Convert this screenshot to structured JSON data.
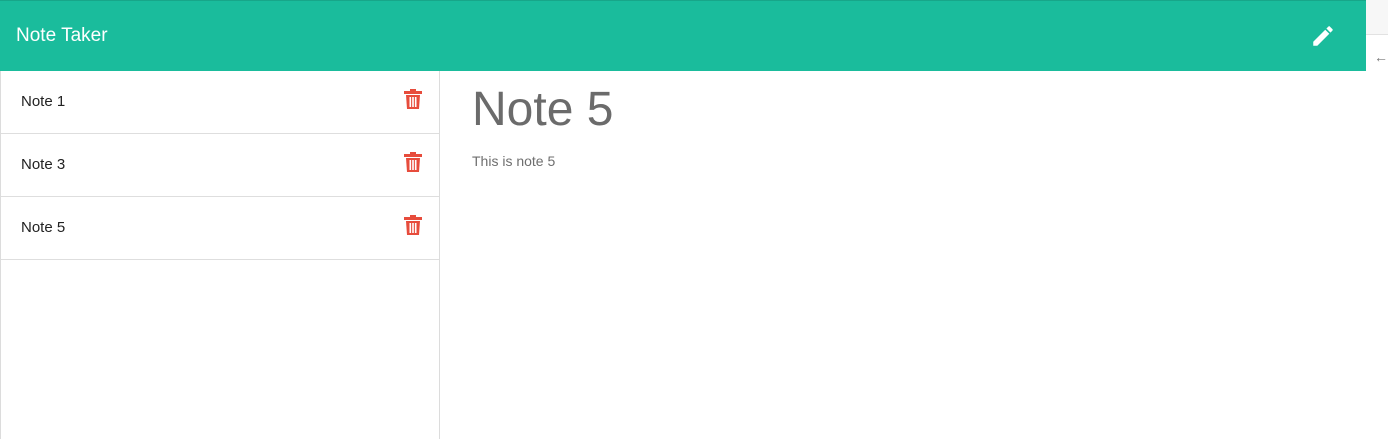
{
  "app": {
    "brand": "Note Taker",
    "accent_color": "#1abc9c",
    "delete_color": "#e74c3c",
    "new_note_icon": "pencil-icon"
  },
  "notes": [
    {
      "title": "Note 1"
    },
    {
      "title": "Note 3"
    },
    {
      "title": "Note 5"
    }
  ],
  "active_note": {
    "title": "Note 5",
    "body": "This is note 5"
  },
  "edge": {
    "arrow": "←"
  }
}
